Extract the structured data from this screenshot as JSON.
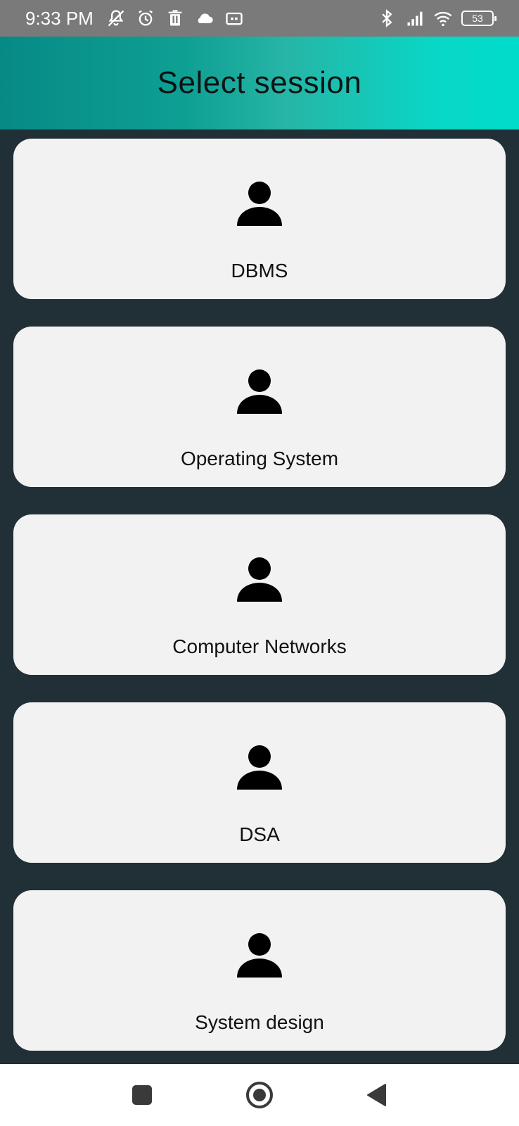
{
  "status_bar": {
    "time": "9:33 PM",
    "battery": "53",
    "icons": [
      "muted-bell-icon",
      "alarm-icon",
      "trash-icon",
      "cloud-icon",
      "cast-icon",
      "bluetooth-icon",
      "signal-icon",
      "wifi-icon",
      "battery-icon"
    ]
  },
  "header": {
    "title": "Select session"
  },
  "sessions": [
    {
      "label": "DBMS",
      "icon": "person-icon"
    },
    {
      "label": "Operating System",
      "icon": "person-icon"
    },
    {
      "label": "Computer Networks",
      "icon": "person-icon"
    },
    {
      "label": "DSA",
      "icon": "person-icon"
    },
    {
      "label": "System design",
      "icon": "person-icon"
    }
  ],
  "nav_bar": {
    "buttons": [
      "recents-icon",
      "home-icon",
      "back-icon"
    ]
  },
  "colors": {
    "background": "#212f37",
    "card": "#f2f2f2",
    "header_gradient_start": "#078a86",
    "header_gradient_end": "#00dcca",
    "status_bar": "#7a7a7a"
  }
}
